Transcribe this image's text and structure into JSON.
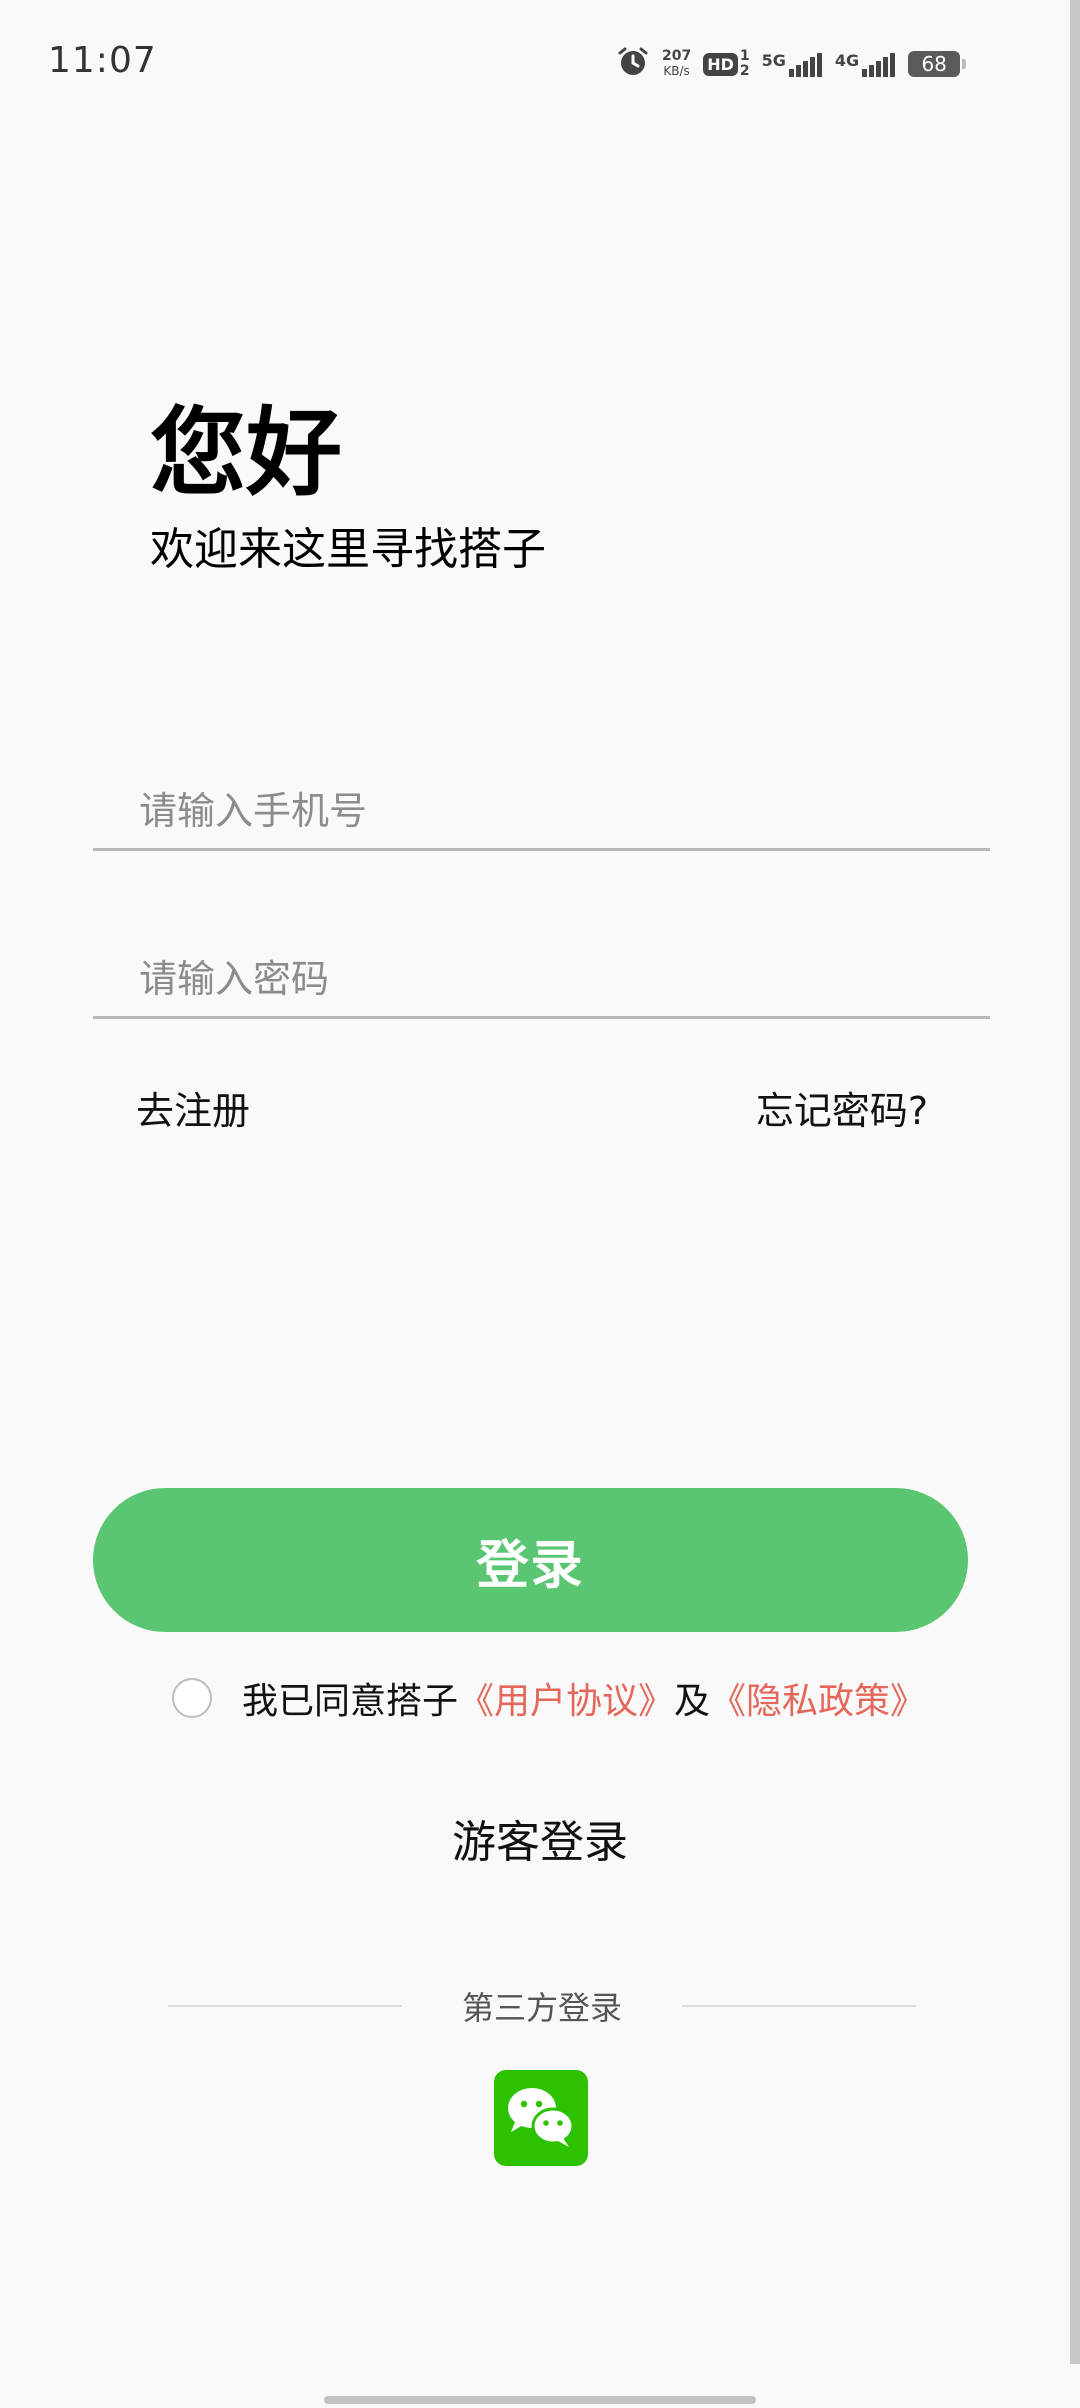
{
  "status_bar": {
    "time": "11:07",
    "speed_value": "207",
    "speed_unit": "KB/s",
    "hd_label": "HD",
    "hd_sim_top": "1",
    "hd_sim_bottom": "2",
    "net1_label": "5G",
    "net2_label": "4G",
    "battery_level": "68",
    "icons": [
      "alarm-icon",
      "hd-voice-icon",
      "signal-5g-icon",
      "signal-4g-icon",
      "battery-icon"
    ]
  },
  "header": {
    "greeting": "您好",
    "subtitle": "欢迎来这里寻找搭子"
  },
  "form": {
    "phone_placeholder": "请输入手机号",
    "password_placeholder": "请输入密码",
    "register_link": "去注册",
    "forgot_link": "忘记密码?"
  },
  "login": {
    "button_label": "登录"
  },
  "agreement": {
    "prefix": "我已同意搭子",
    "user_agreement": "《用户协议》",
    "and": "及",
    "privacy_policy": "《隐私政策》"
  },
  "guest": {
    "label": "游客登录"
  },
  "third_party": {
    "label": "第三方登录",
    "icon": "wechat-icon"
  },
  "colors": {
    "background": "#f9f9f9",
    "primary_green": "#5bc672",
    "link_red": "#e5675a",
    "wechat_green": "#2dc100"
  }
}
